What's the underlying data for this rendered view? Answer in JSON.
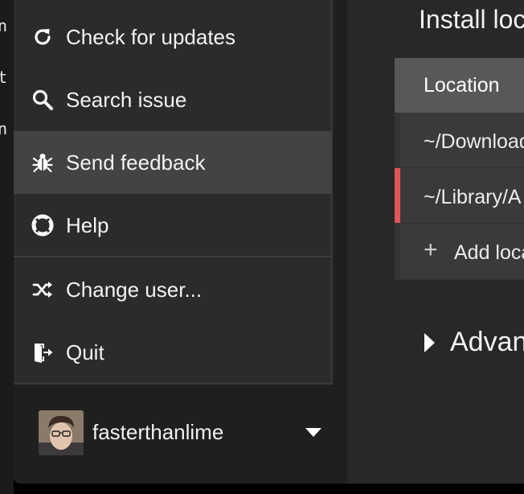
{
  "terminal_fragments": [
    "n",
    "t",
    "n"
  ],
  "menu": {
    "items": [
      {
        "label": "Check for updates",
        "icon": "refresh-icon"
      },
      {
        "label": "Search issue",
        "icon": "search-icon"
      },
      {
        "label": "Send feedback",
        "icon": "bug-icon",
        "hovered": true
      },
      {
        "label": "Help",
        "icon": "lifebuoy-icon"
      },
      {
        "label": "Change user...",
        "icon": "shuffle-icon"
      },
      {
        "label": "Quit",
        "icon": "exit-door-icon"
      }
    ]
  },
  "user": {
    "name": "fasterthanlime"
  },
  "main": {
    "title": "Install loc",
    "table": {
      "header": "Location",
      "rows": [
        "~/Download",
        "~/Library/A"
      ],
      "add_label": "Add loca"
    },
    "advanced_label": "Advanc"
  },
  "colors": {
    "active_marker": "#e0545a",
    "menu_bg": "#2b2b2b",
    "hover_bg": "#434343"
  }
}
